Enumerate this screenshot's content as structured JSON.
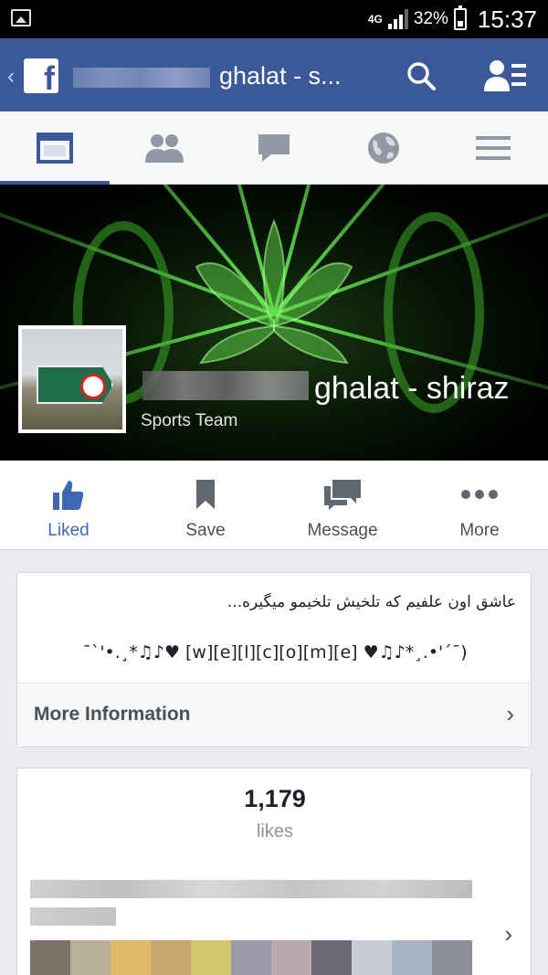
{
  "status_bar": {
    "network": "4G",
    "battery": "32%",
    "time": "15:37"
  },
  "header": {
    "title_visible": "ghalat - s..."
  },
  "tabs": [
    {
      "name": "timeline",
      "icon": "page-icon",
      "active": true
    },
    {
      "name": "friends",
      "icon": "friends-icon",
      "active": false
    },
    {
      "name": "messages",
      "icon": "chat-icon",
      "active": false
    },
    {
      "name": "notifications",
      "icon": "globe-icon",
      "active": false
    },
    {
      "name": "menu",
      "icon": "hamburger-icon",
      "active": false
    }
  ],
  "page": {
    "name_visible": "ghalat - shiraz",
    "category": "Sports Team"
  },
  "actions": [
    {
      "label": "Liked",
      "icon": "thumbs-up-icon",
      "active": true
    },
    {
      "label": "Save",
      "icon": "bookmark-icon",
      "active": false
    },
    {
      "label": "Message",
      "icon": "chat-bubbles-icon",
      "active": false
    },
    {
      "label": "More",
      "icon": "more-dots-icon",
      "active": false
    }
  ],
  "about": {
    "description": "عاشق اون علفیم که تلخیش تلخیمو میگیره...",
    "welcome": "¯`'•.¸*♫♪♥ [w][e][l][c][o][m][e] ♥♫♪*¸.•'´¯)",
    "more_info_label": "More Information"
  },
  "likes": {
    "count": "1,179",
    "label": "likes"
  },
  "colors": {
    "brand": "#3b5998",
    "liked": "#4267b2",
    "tab_bg": "#f6f7f9"
  }
}
